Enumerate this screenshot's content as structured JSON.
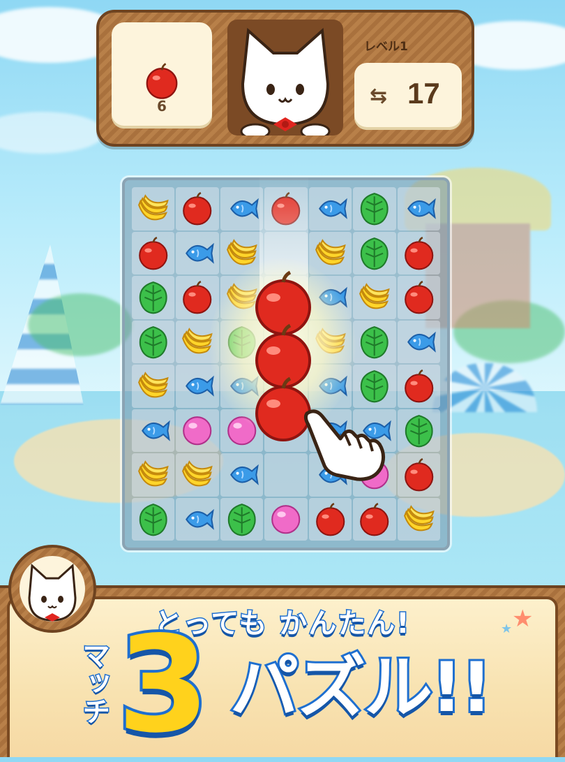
{
  "hud": {
    "goal": {
      "icon": "apple-icon",
      "count": "6"
    },
    "level_label": "レベル1",
    "moves": {
      "icon": "swap-arrows-icon",
      "count": "17"
    }
  },
  "board": {
    "rows": 8,
    "cols": 7,
    "tiles": [
      [
        "banana",
        "apple",
        "fish",
        "apple",
        "fish",
        "leaf",
        "fish"
      ],
      [
        "apple",
        "fish",
        "banana",
        "empty",
        "banana",
        "leaf",
        "apple"
      ],
      [
        "leaf",
        "apple",
        "banana",
        "empty",
        "fish",
        "banana",
        "apple"
      ],
      [
        "leaf",
        "banana",
        "leaf",
        "empty",
        "banana",
        "leaf",
        "fish"
      ],
      [
        "banana",
        "fish",
        "fish",
        "empty",
        "fish",
        "leaf",
        "apple"
      ],
      [
        "fish",
        "pink",
        "pink",
        "empty",
        "fish",
        "fish",
        "leaf"
      ],
      [
        "banana",
        "banana",
        "fish",
        "empty",
        "fish",
        "pink",
        "apple"
      ],
      [
        "leaf",
        "fish",
        "leaf",
        "pink",
        "apple",
        "apple",
        "banana"
      ]
    ],
    "highlight_match": {
      "tile": "apple",
      "count": 3
    }
  },
  "banner": {
    "tagline": "とっても かんたん!",
    "match_label": "マッチ",
    "big_number": "3",
    "puzzle_label": "パズル!!"
  },
  "colors": {
    "apple": "#e02a1f",
    "banana": "#ffd52a",
    "fish": "#3b9be8",
    "leaf": "#3cc04a",
    "pink": "#f06bc8",
    "wood": "#a9713d",
    "text_outline": "#1e6fd0"
  }
}
